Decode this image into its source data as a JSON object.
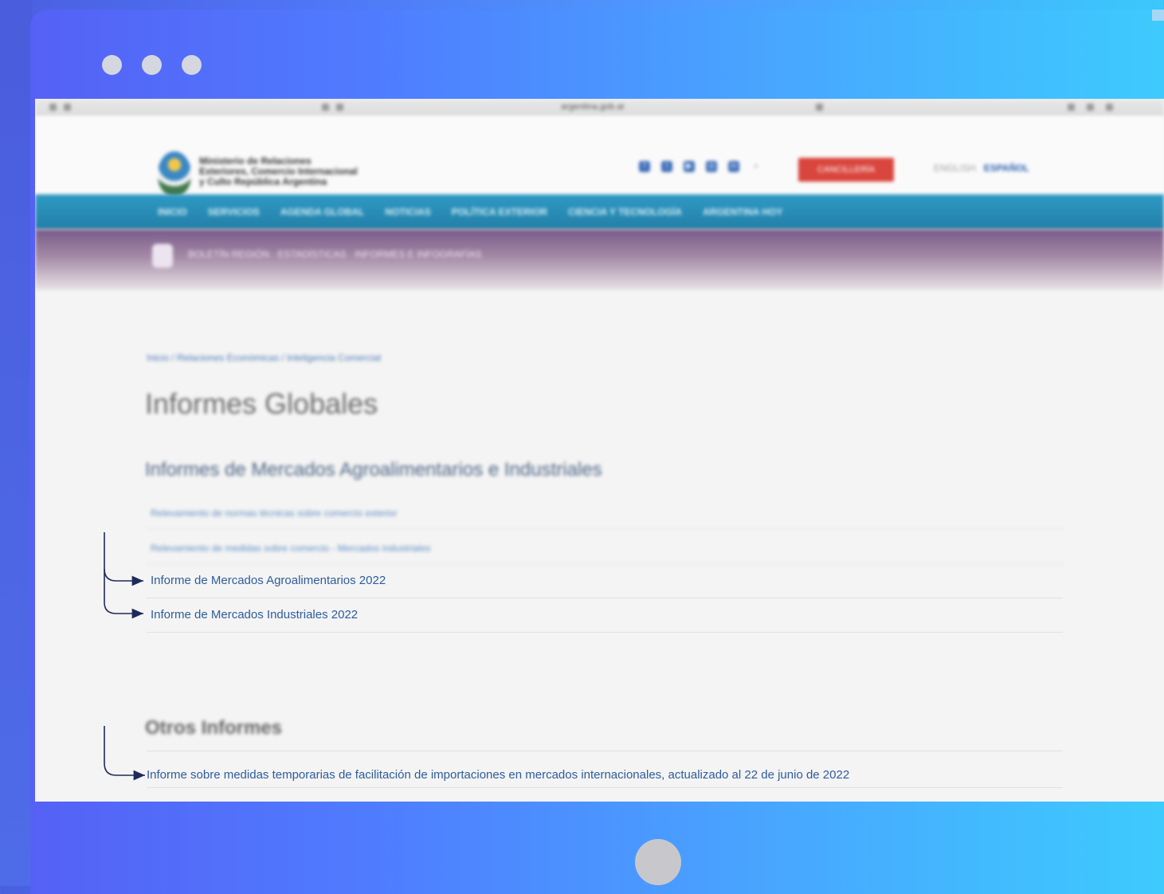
{
  "window": {
    "controls": [
      "close",
      "minimize",
      "maximize"
    ]
  },
  "browser": {
    "url": "argentina.gob.ar"
  },
  "site": {
    "brand": "Ministerio de Relaciones Exteriores, Comercio Internacional y Culto República Argentina",
    "social_icons": [
      "facebook-icon",
      "twitter-icon",
      "youtube-icon",
      "instagram-icon",
      "linkedin-icon",
      "search-icon"
    ],
    "red_button": "CANCILLERÍA",
    "lang_inactive": "ENGLISH",
    "lang_active": "ESPAÑOL",
    "nav": [
      "INICIO",
      "SERVICIOS",
      "AGENDA GLOBAL",
      "NOTICIAS",
      "POLÍTICA EXTERIOR",
      "CIENCIA Y TECNOLOGÍA",
      "ARGENTINA HOY"
    ],
    "subnav": "BOLETÍN REGIÓN · ESTADÍSTICAS · INFORMES E INFOGRAFÍAS"
  },
  "content": {
    "breadcrumb": "Inicio / Relaciones Económicas / Inteligencia Comercial",
    "title": "Informes Globales",
    "section_title": "Informes de Mercados Agroalimentarios e Industriales",
    "links": [
      "Relevamiento de normas técnicas sobre comercio exterior",
      "Relevamiento de medidas sobre comercio - Mercados industriales",
      "Informe de Mercados Agroalimentarios 2022",
      "Informe de Mercados Industriales 2022"
    ],
    "others_title": "Otros Informes",
    "others_links": [
      "Informe sobre medidas temporarias de facilitación de importaciones en mercados internacionales, actualizado al 22 de junio de 2022"
    ]
  }
}
